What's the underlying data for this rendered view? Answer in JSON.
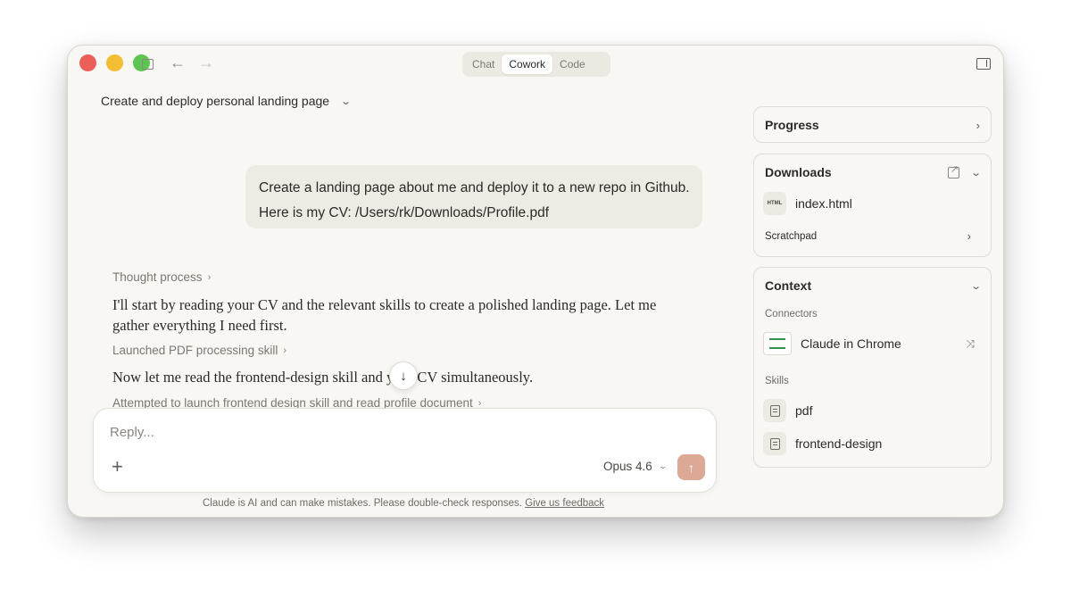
{
  "window": {
    "mode_tabs": [
      {
        "label": "Chat",
        "active": false
      },
      {
        "label": "Cowork",
        "active": true
      },
      {
        "label": "Code",
        "active": false
      }
    ]
  },
  "task": {
    "title": "Create and deploy personal landing page"
  },
  "conversation": {
    "user_message": {
      "line1": "Create a landing page about me and deploy it to a new repo in Github.",
      "line2": "Here is my CV: /Users/rk/Downloads/Profile.pdf"
    },
    "thought_process_label": "Thought process",
    "assistant_text_1_line1": "I'll start by reading your CV and the relevant skills to create a polished landing page. Let me",
    "assistant_text_1_line2": "gather everything I need first.",
    "tool_step_1": "Launched PDF processing skill",
    "assistant_text_2": "Now let me read the frontend-design skill and your CV simultaneously.",
    "tool_step_2": "Attempted to launch frontend design skill and read profile document"
  },
  "composer": {
    "placeholder": "Reply...",
    "model": "Opus 4.6",
    "disclaimer": "Claude is AI and can make mistakes. Please double-check responses.",
    "feedback_link": "Give us feedback"
  },
  "panel": {
    "progress": {
      "title": "Progress"
    },
    "downloads": {
      "title": "Downloads",
      "file_name": "index.html",
      "file_type": "HTML",
      "scratchpad": "Scratchpad"
    },
    "context": {
      "title": "Context",
      "connectors_label": "Connectors",
      "connector_name": "Claude in Chrome",
      "skills_label": "Skills",
      "skills": [
        "pdf",
        "frontend-design"
      ]
    }
  },
  "colors": {
    "background": "#f8f7f3",
    "send_button": "#dba995",
    "bubble": "#eeebe4"
  },
  "icons": [
    "sidebar-icon",
    "back-arrow-icon",
    "forward-arrow-icon",
    "panel-toggle-icon",
    "chevron-down-icon",
    "chevron-right-icon",
    "arrow-down-icon",
    "plus-icon",
    "arrow-up-icon",
    "external-link-icon",
    "html-file-icon",
    "chrome-icon",
    "shuffle-icon",
    "document-icon"
  ]
}
